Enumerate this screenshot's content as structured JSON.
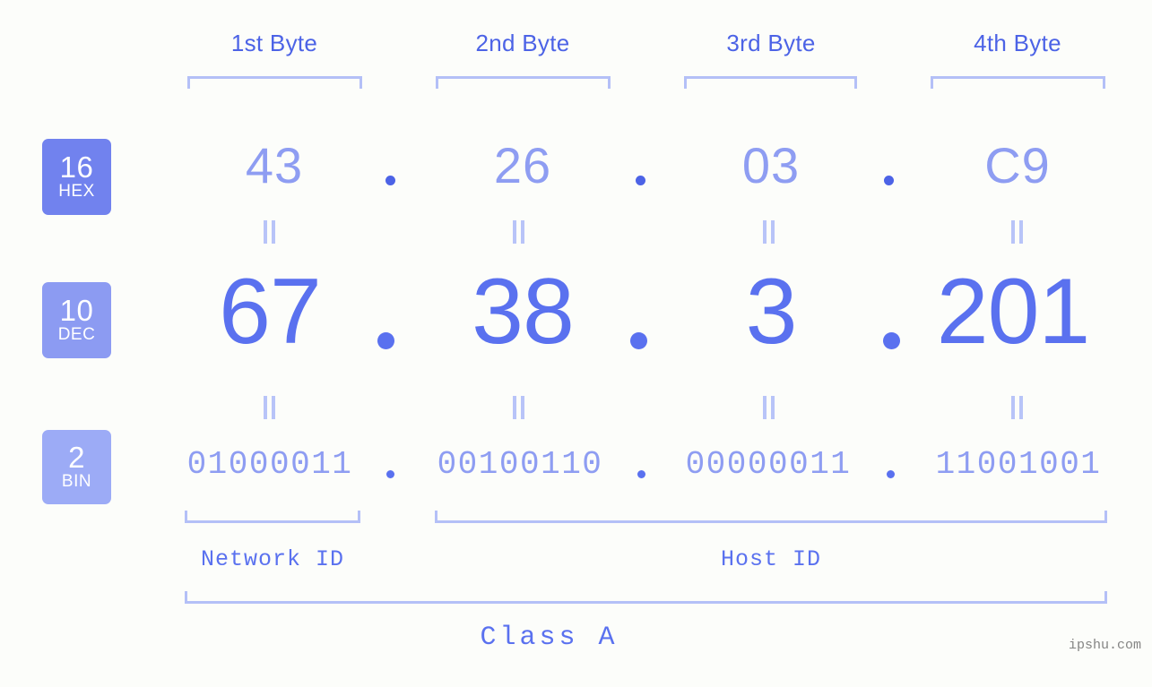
{
  "background_color": "#fcfdfa",
  "accent_color": "#5a71ef",
  "bracket_color": "#b4c0f7",
  "byte_headers": [
    {
      "label": "1st Byte"
    },
    {
      "label": "2nd Byte"
    },
    {
      "label": "3rd Byte"
    },
    {
      "label": "4th Byte"
    }
  ],
  "base_badges": [
    {
      "number": "16",
      "base": "HEX",
      "color": "#7182ee"
    },
    {
      "number": "10",
      "base": "DEC",
      "color": "#8c9bf2"
    },
    {
      "number": "2",
      "base": "BIN",
      "color": "#9cabf6"
    }
  ],
  "rows": {
    "hex": {
      "values": [
        "43",
        "26",
        "03",
        "C9"
      ],
      "separator": "."
    },
    "dec": {
      "values": [
        "67",
        "38",
        "3",
        "201"
      ],
      "separator": "."
    },
    "bin": {
      "values": [
        "01000011",
        "00100110",
        "00000011",
        "11001001"
      ],
      "separator": "."
    }
  },
  "equals_symbol": "=",
  "segments": [
    {
      "label": "Network ID"
    },
    {
      "label": "Host ID"
    }
  ],
  "class_label": "Class A",
  "watermark": "ipshu.com"
}
